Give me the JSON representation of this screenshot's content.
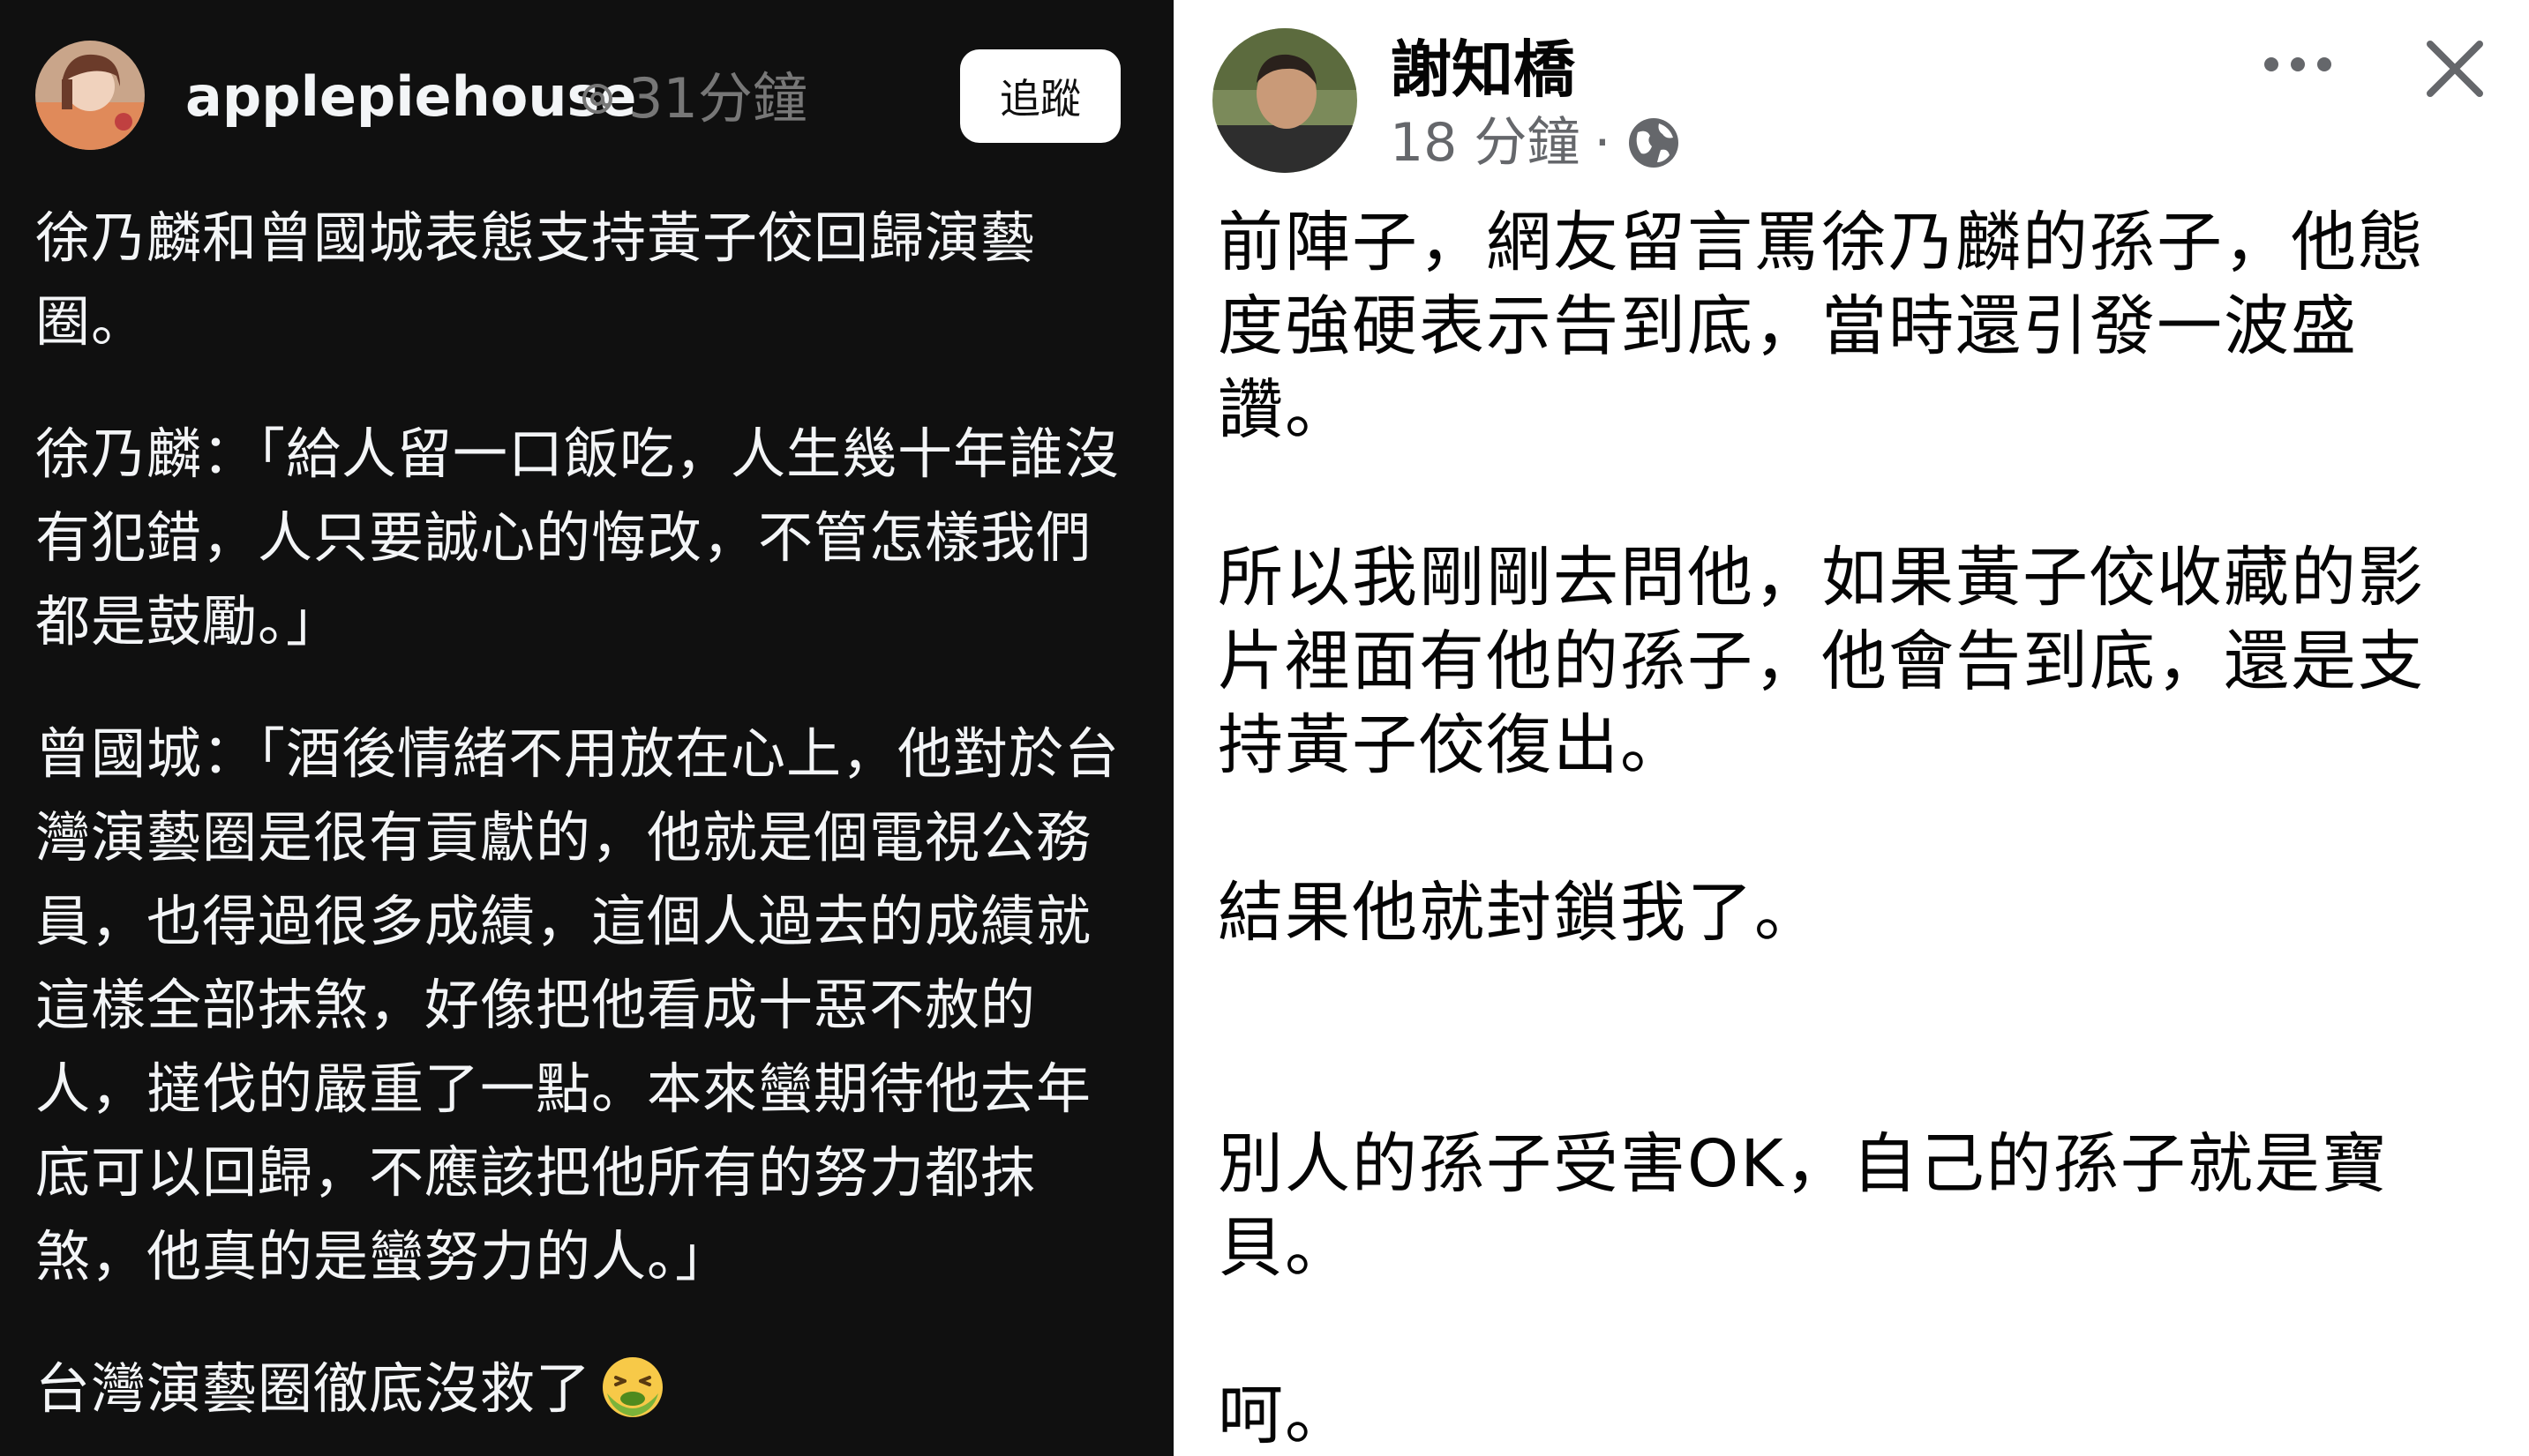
{
  "left_post": {
    "username": "applepiehouse",
    "time_ago": "31分鐘",
    "follow_button": "追蹤",
    "paragraphs": [
      "徐乃麟和曾國城表態支持黃子佼回歸演藝圈。",
      "徐乃麟：「給人留一口飯吃，人生幾十年誰沒有犯錯，人只要誠心的悔改，不管怎樣我們都是鼓勵。」",
      "曾國城：「酒後情緒不用放在心上，他對於台灣演藝圈是很有貢獻的，他就是個電視公務員，也得過很多成績，這個人過去的成績就這樣全部抹煞，好像把他看成十惡不赦的人，撻伐的嚴重了一點。本來蠻期待他去年底可以回歸，不應該把他所有的努力都抹煞，他真的是蠻努力的人。」",
      "台灣演藝圈徹底沒救了"
    ],
    "emoji": "nauseated-face-icon",
    "colors": {
      "background": "#101010",
      "text": "#f3f5f7",
      "muted": "#777777"
    }
  },
  "right_post": {
    "author": "謝知橋",
    "time_ago": "18 分鐘",
    "separator": "·",
    "audience": "globe-icon",
    "paragraphs": [
      "前陣子，網友留言罵徐乃麟的孫子，他態度強硬表示告到底，當時還引發一波盛讚。",
      "所以我剛剛去問他，如果黃子佼收藏的影片裡面有他的孫子，他會告到底，還是支持黃子佼復出。",
      "結果他就封鎖我了。",
      "別人的孫子受害OK，自己的孫子就是寶貝。",
      "呵。"
    ],
    "colors": {
      "background": "#ffffff",
      "text": "#050505",
      "muted": "#65676b"
    }
  }
}
